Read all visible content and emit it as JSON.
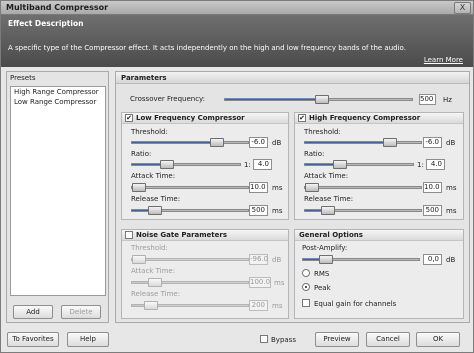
{
  "window": {
    "title": "Multiband Compressor",
    "close": "X"
  },
  "description": {
    "heading": "Effect Description",
    "text": "A specific type of the Compressor effect. It acts independently on the high and low frequency bands of the audio.",
    "learn_more": "Learn More"
  },
  "presets": {
    "heading": "Presets",
    "items": [
      "High Range Compressor",
      "Low Range Compressor"
    ],
    "add": "Add",
    "delete": "Delete"
  },
  "parameters": {
    "heading": "Parameters",
    "crossover": {
      "label": "Crossover Frequency:",
      "value": "500",
      "unit": "Hz",
      "level": 0.52
    },
    "low": {
      "title": "Low Frequency Compressor",
      "checked": true,
      "threshold": {
        "label": "Threshold:",
        "value": "-6.0",
        "unit": "dB",
        "level": 0.73
      },
      "ratio": {
        "label": "Ratio:",
        "prefix": "1:",
        "value": "4.0",
        "level": 0.32
      },
      "attack": {
        "label": "Attack Time:",
        "value": "10.0",
        "unit": "ms",
        "level": 0.02
      },
      "release": {
        "label": "Release Time:",
        "value": "500",
        "unit": "ms",
        "level": 0.2
      }
    },
    "high": {
      "title": "High Frequency Compressor",
      "checked": true,
      "threshold": {
        "label": "Threshold:",
        "value": "-6.0",
        "unit": "dB",
        "level": 0.73
      },
      "ratio": {
        "label": "Ratio:",
        "prefix": "1:",
        "value": "4.0",
        "level": 0.32
      },
      "attack": {
        "label": "Attack Time:",
        "value": "10.0",
        "unit": "ms",
        "level": 0.02
      },
      "release": {
        "label": "Release Time:",
        "value": "500",
        "unit": "ms",
        "level": 0.2
      }
    },
    "noise": {
      "title": "Noise Gate Parameters",
      "checked": false,
      "threshold": {
        "label": "Threshold:",
        "value": "-96.0",
        "unit": "dB",
        "level": 0.0
      },
      "attack": {
        "label": "Attack Time:",
        "value": "100.0",
        "unit": "ms",
        "level": 0.2
      },
      "release": {
        "label": "Release Time:",
        "value": "200",
        "unit": "ms",
        "level": 0.16
      }
    },
    "general": {
      "title": "General Options",
      "post_amplify": {
        "label": "Post-Amplify:",
        "value": "0,0",
        "unit": "dB",
        "level": 0.2
      },
      "rms": "RMS",
      "peak": "Peak",
      "mode": "Peak",
      "equal_gain": "Equal gain for channels"
    }
  },
  "footer": {
    "favorites": "To Favorites",
    "help": "Help",
    "bypass": "Bypass",
    "preview": "Preview",
    "cancel": "Cancel",
    "ok": "OK"
  }
}
